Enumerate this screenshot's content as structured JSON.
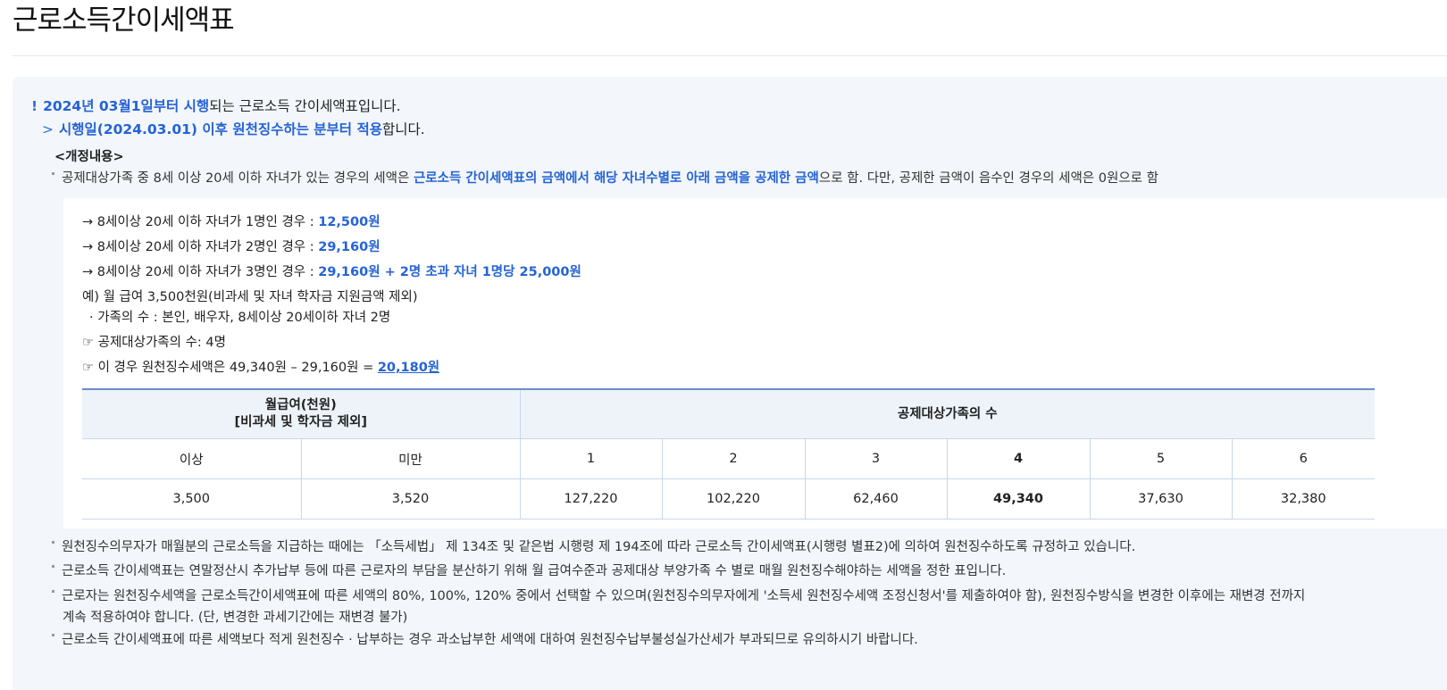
{
  "page": {
    "title": "근로소득간이세액표"
  },
  "notice": {
    "line1_highlight": "2024년 03월1일부터 시행",
    "line1_rest": "되는 근로소득 간이세액표입니다.",
    "line2_highlight": "시행일(2024.03.01) 이후 원천징수하는 분부터 적용",
    "line2_rest": "합니다."
  },
  "revision": {
    "heading": "<개정내용>",
    "bullet_pre": "공제대상가족 중 8세 이상 20세 이하 자녀가 있는 경우의 세액은 ",
    "bullet_highlight": "근로소득 간이세액표의 금액에서 해당 자녀수별로 아래 금액을 공제한 금액",
    "bullet_post": "으로 함. 다만, 공제한 금액이 음수인 경우의 세액은 0원으로 함"
  },
  "example": {
    "child1_label": "→ 8세이상 20세 이하 자녀가 1명인 경우 : ",
    "child1_value": "12,500원",
    "child2_label": "→ 8세이상 20세 이하 자녀가 2명인 경우 : ",
    "child2_value": "29,160원",
    "child3_label": "→ 8세이상 20세 이하 자녀가 3명인 경우 : ",
    "child3_value": "29,160원 + 2명 초과 자녀 1명당 25,000원",
    "example_line": "예) 월 급여 3,500천원(비과세 및 자녀 학자금 지원금액 제외)",
    "family_line": "· 가족의 수 : 본인, 배우자, 8세이상 20세이하 자녀 2명",
    "deduct_count": "☞ 공제대상가족의 수: 4명",
    "result_pre": "☞ 이 경우 원천징수세액은 49,340원 – 29,160원 = ",
    "result_value": "20,180원"
  },
  "table": {
    "salary_header_line1": "월급여(천원)",
    "salary_header_line2": "[비과세 및 학자금 제외]",
    "family_header": "공제대상가족의 수",
    "sub_headers": [
      "이상",
      "미만",
      "1",
      "2",
      "3",
      "4",
      "5",
      "6"
    ],
    "row": [
      "3,500",
      "3,520",
      "127,220",
      "102,220",
      "62,460",
      "49,340",
      "37,630",
      "32,380"
    ],
    "highlight_column": "4"
  },
  "footnotes": [
    "원천징수의무자가 매월분의 근로소득을 지급하는 때에는 「소득세법」 제 134조 및 같은법 시행령 제 194조에 따라 근로소득 간이세액표(시행령 별표2)에 의하여 원천징수하도록 규정하고 있습니다.",
    "근로소득 간이세액표는 연말정산시 추가납부 등에 따른 근로자의 부담을 분산하기 위해 월 급여수준과 공제대상 부양가족 수 별로 매월 원천징수해야하는 세액을 정한 표입니다.",
    "근로자는 원천징수세액을 근로소득간이세액표에 따른 세액의 80%, 100%, 120% 중에서 선택할 수 있으며(원천징수의무자에게 '소득세 원천징수세액 조정신청서'를 제출하여야 함), 원천징수방식을 변경한 이후에는 재변경 전까지",
    "계속 적용하여야 합니다. (단, 변경한 과세기간에는 재변경 불가)",
    "근로소득 간이세액표에 따른 세액보다 적게 원천징수 · 납부하는 경우 과소납부한 세액에 대하여 원천징수납부불성실가산세가 부과되므로 유의하시기 바랍니다."
  ],
  "colors": {
    "accent": "#2563d4",
    "panel_bg": "#f3f6fb",
    "table_header_bg": "#eef3fa"
  }
}
